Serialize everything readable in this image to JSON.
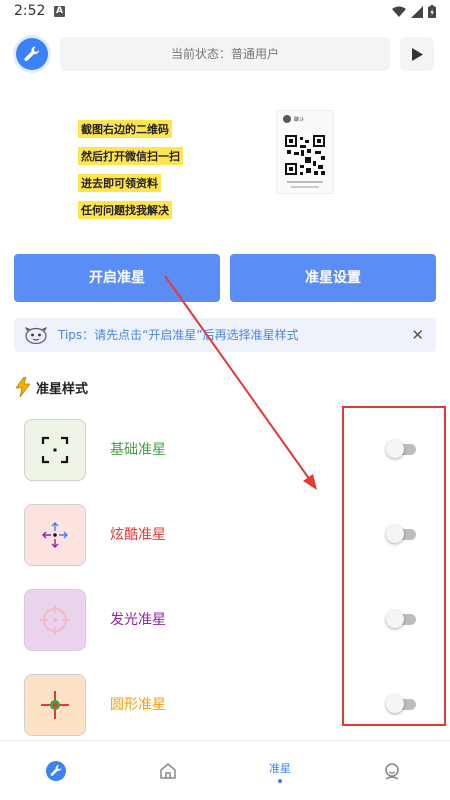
{
  "status_bar": {
    "time": "2:52",
    "notif_letter": "A"
  },
  "header": {
    "status_text": "当前状态：普通用户"
  },
  "banner": {
    "lines": [
      "截图右边的二维码",
      "然后打开微信扫一扫",
      "进去即可领资料",
      "任何问题找我解决"
    ],
    "qr_name": "聊斗"
  },
  "buttons": {
    "open_crosshair": "开启准星",
    "crosshair_settings": "准星设置"
  },
  "tips": {
    "text": "Tips：请先点击“开启准星”后再选择准星样式",
    "close": "✕"
  },
  "section": {
    "title": "准星样式"
  },
  "styles": [
    {
      "label": "基础准星",
      "color": "#43a047",
      "icon_bg": "#eef5e6",
      "enabled": false
    },
    {
      "label": "炫酷准星",
      "color": "#e53935",
      "icon_bg": "#fde3df",
      "enabled": false
    },
    {
      "label": "发光准星",
      "color": "#8e24aa",
      "icon_bg": "#ead3ec",
      "enabled": false
    },
    {
      "label": "圆形准星",
      "color": "#f59e0b",
      "icon_bg": "#fde3c6",
      "enabled": false
    }
  ],
  "bottom_nav": {
    "active_label": "准星"
  },
  "colors": {
    "accent": "#3b82f6",
    "button": "#5b8df6",
    "annotation": "#e53935"
  },
  "icons": [
    "wrench-icon",
    "play-icon",
    "home-icon",
    "user-icon",
    "lightning-icon",
    "close-icon",
    "wifi-icon",
    "signal-icon",
    "battery-icon"
  ]
}
